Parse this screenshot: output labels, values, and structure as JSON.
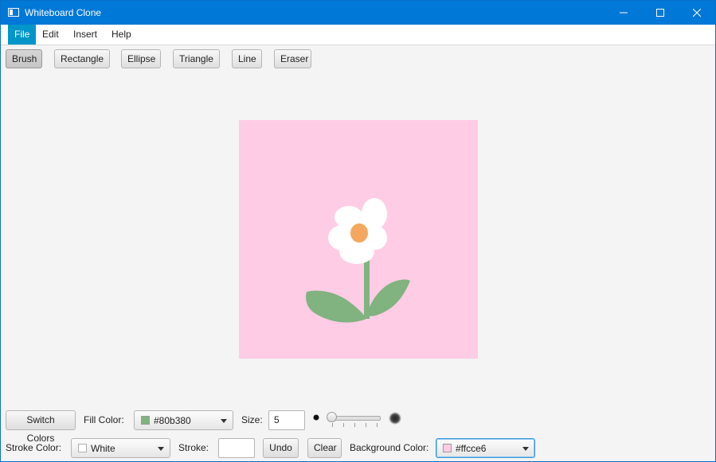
{
  "window": {
    "title": "Whiteboard Clone"
  },
  "menu": [
    "File",
    "Edit",
    "Insert",
    "Help"
  ],
  "tools": [
    "Brush",
    "Rectangle",
    "Ellipse",
    "Triangle",
    "Line",
    "Eraser"
  ],
  "selected_tool": "Brush",
  "controls": {
    "switch_colors": "Switch Colors",
    "fill_color_label": "Fill Color:",
    "fill_color_value": "#80b380",
    "size_label": "Size:",
    "size_value": "5",
    "stroke_color_label": "Stroke Color:",
    "stroke_color_value": "White",
    "stroke_label": "Stroke:",
    "stroke_value": "",
    "undo": "Undo",
    "clear": "Clear",
    "background_color_label": "Background Color:",
    "background_color_value": "#ffcce6"
  },
  "colors": {
    "accent": "#0078d7",
    "menu_active": "#0096c9",
    "canvas_bg": "#ffcce6",
    "fill": "#80b380",
    "stroke": "#ffffff",
    "flower_center": "#f5a75f"
  },
  "icons": {
    "app": "window-icon",
    "minimize": "minimize-icon",
    "maximize": "maximize-icon",
    "close": "close-icon"
  }
}
